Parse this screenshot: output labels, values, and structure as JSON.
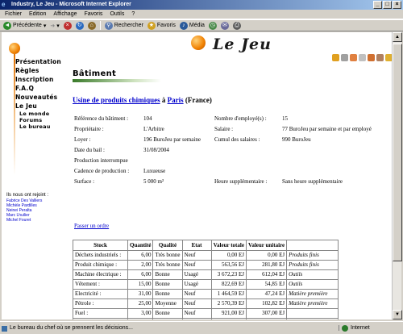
{
  "window": {
    "title": "Industry, Le Jeu - Microsoft Internet Explorer",
    "controls": [
      "_",
      "□",
      "×"
    ]
  },
  "menu": [
    "Fichier",
    "Edition",
    "Affichage",
    "Favoris",
    "Outils",
    "?"
  ],
  "toolbar": {
    "back": "Précédente",
    "search": "Rechercher",
    "favorites": "Favoris",
    "media": "Média"
  },
  "site": {
    "logo": "Le Jeu"
  },
  "nav": {
    "items": [
      "Présentation",
      "Règles",
      "Inscription",
      "F.A.Q",
      "Nouveautés",
      "Le Jeu"
    ],
    "sub": [
      "Le monde",
      "Forums",
      "Le bureau"
    ]
  },
  "joined": {
    "title": "Ils nous ont rejoint :",
    "members": [
      "Fabrice Des Valliers",
      "Michèle Pardilles",
      "Neinei Peralta",
      "Marc Lhuilier",
      "Michel Fouret"
    ]
  },
  "section": {
    "title": "Bâtiment"
  },
  "factory": {
    "name": "Usine de produits chimiques",
    "preposition": "à",
    "city": "Paris",
    "country": "(France)"
  },
  "info": {
    "left": [
      {
        "label": "Référence du bâtiment :",
        "value": "104"
      },
      {
        "label": "Propriétaire :",
        "value": "L'Arbitre"
      },
      {
        "label": "Loyer :",
        "value": "196 BuroJeu par semaine"
      },
      {
        "label": "Date du bail :",
        "value": "31/08/2004"
      },
      {
        "label": "Production interrompue",
        "value": ""
      },
      {
        "label": "Cadence de production :",
        "value": "Luxueuse"
      },
      {
        "label": "Surface :",
        "value": "5 000 m²"
      }
    ],
    "right": [
      {
        "label": "Nombre d'employé(s) :",
        "value": "15"
      },
      {
        "label": "Salaire :",
        "value": "77 BuroJeu par semaine et par employé"
      },
      {
        "label": "Cumul des salaires :",
        "value": "990 BuroJeu"
      },
      {
        "label": "",
        "value": ""
      },
      {
        "label": "",
        "value": ""
      },
      {
        "label": "",
        "value": ""
      },
      {
        "label": "Heure supplémentaire :",
        "value": "Sans heure supplémentaire"
      }
    ]
  },
  "order_link": "Passer un ordre",
  "stock_table": {
    "headers": [
      "Stock",
      "Quantité",
      "Qualité",
      "Etat",
      "Valeur totale",
      "Valeur unitaire",
      ""
    ],
    "rows": [
      [
        "Déchets industriels :",
        "6,00",
        "Très bonne",
        "Neuf",
        "0,00 EJ",
        "0,00 EJ",
        "Produits finis"
      ],
      [
        "Produit chimique :",
        "2,00",
        "Très bonne",
        "Neuf",
        "563,56 EJ",
        "281,80 EJ",
        "Produits finis"
      ],
      [
        "Machine électrique :",
        "6,00",
        "Bonne",
        "Usagé",
        "3 672,23 EJ",
        "612,04 EJ",
        "Outils"
      ],
      [
        "Vêtement :",
        "15,00",
        "Bonne",
        "Usagé",
        "822,69 EJ",
        "54,85 EJ",
        "Outils"
      ],
      [
        "Electricité :",
        "31,00",
        "Bonne",
        "Neuf",
        "1 464,59 EJ",
        "47,24 EJ",
        "Matière première"
      ],
      [
        "Pétrole :",
        "25,00",
        "Moyenne",
        "Neuf",
        "2 570,39 EJ",
        "102,82 EJ",
        "Matière première"
      ],
      [
        "Fuel :",
        "3,00",
        "Bonne",
        "Neuf",
        "921,00 EJ",
        "307,00 EJ",
        ""
      ],
      [
        "Imprimé :",
        "23,00",
        "Bonne",
        "Neuf",
        "4 283,96 EJ",
        "186,26 EJ",
        ""
      ],
      [
        "Ordinateur :",
        "2,00",
        "Bonne",
        "Quasi-neuf",
        "698,00 EJ",
        "349,00 EJ",
        ""
      ]
    ]
  },
  "status": {
    "text": "Le bureau du chef où se prennent les décisions...",
    "zone": "Internet"
  },
  "colors": {
    "titlebar_start": "#0a246a",
    "accent_orange": "#f08000",
    "link": "#0000cc"
  }
}
